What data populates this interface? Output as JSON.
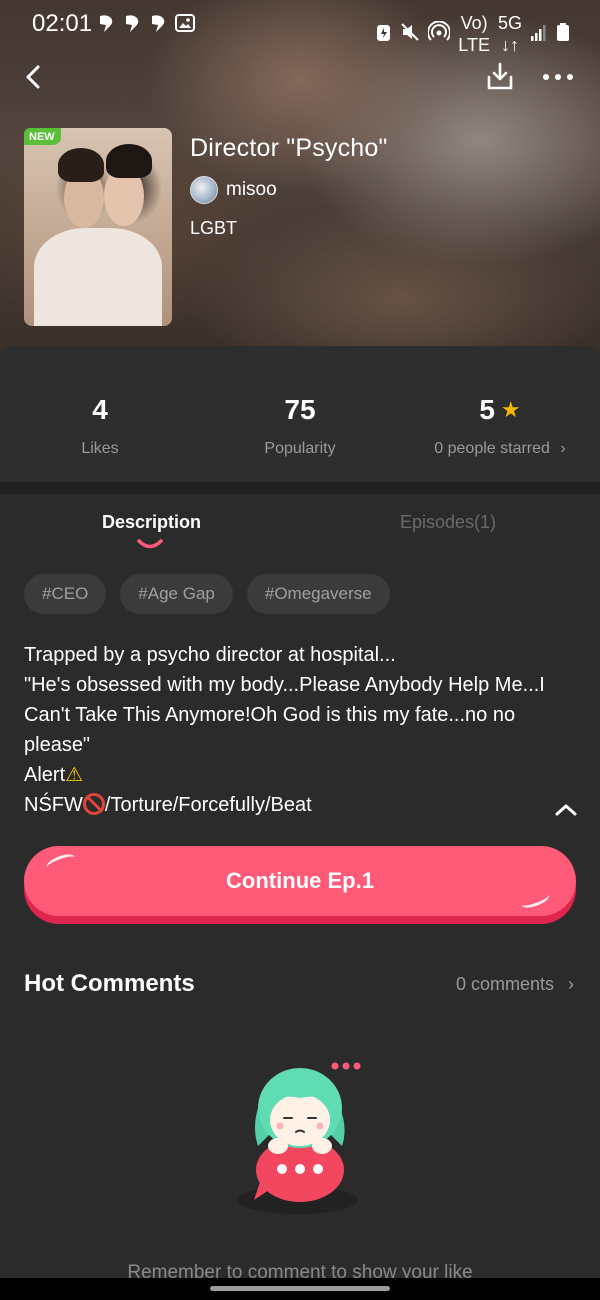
{
  "status_bar": {
    "time": "02:01",
    "network_top": "Vo)",
    "network_bottom": "LTE",
    "gen_top": "5G",
    "gen_bottom": "↓↑"
  },
  "nav": {
    "back_icon": "chevron-left-icon",
    "download_icon": "download-icon",
    "more_icon": "more-horizontal-icon"
  },
  "comic": {
    "badge": "NEW",
    "title": "Director \"Psycho\"",
    "author": "misoo",
    "genre": "LGBT"
  },
  "stats": [
    {
      "value": "4",
      "label": "Likes"
    },
    {
      "value": "75",
      "label": "Popularity"
    },
    {
      "value": "5",
      "label": "0 people starred"
    }
  ],
  "tabs": {
    "description": "Description",
    "episodes": "Episodes(1)"
  },
  "tags": [
    "#CEO",
    "#Age Gap",
    "#Omegaverse"
  ],
  "description": {
    "line1": "Trapped by a psycho director at hospital...",
    "line2": "\"He's obsessed with my body...Please Anybody Help Me...I",
    "line3": "Can't Take This Anymore!Oh God is this my fate...no no",
    "line4": "please\"",
    "line5": "Alert",
    "line6_prefix": "NŚFW",
    "line6_suffix": "/Torture/Forcefully/Beat"
  },
  "cta": {
    "label": "Continue Ep.1"
  },
  "comments": {
    "title": "Hot Comments",
    "count": "0 comments",
    "empty_hint": "Remember to comment to show your like"
  },
  "colors": {
    "accent": "#ff5a78",
    "accent_shadow": "#e0254e",
    "star": "#f5b800",
    "badge_new": "#5bbf3a",
    "background": "#2b2b2b"
  }
}
